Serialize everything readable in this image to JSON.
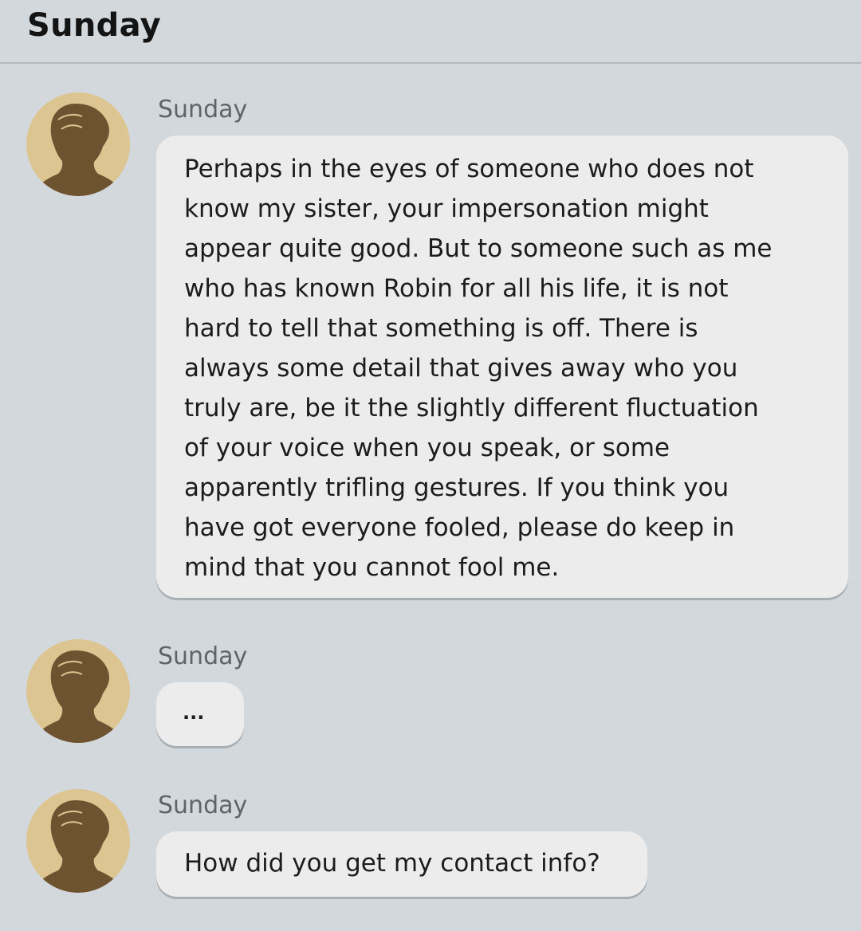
{
  "header": {
    "title": "Sunday"
  },
  "messages": [
    {
      "sender": "Sunday",
      "text": "Perhaps in the eyes of someone who does not\nknow my sister, your impersonation might\nappear quite good. But to someone such as me\nwho has known Robin for all his life, it is not\nhard to tell that something is off. There is\nalways some detail that gives away who you\ntruly are, be it the slightly different fluctuation\nof your voice when you speak, or some\napparently trifling gestures. If you think you\nhave got everyone fooled, please do keep in\nmind that you cannot fool me."
    },
    {
      "sender": "Sunday",
      "text": "..."
    },
    {
      "sender": "Sunday",
      "text": "How did you get my contact info?"
    }
  ],
  "colors": {
    "background": "#d3d8dd",
    "bubble": "#ececec",
    "avatar_bg": "#dcc590",
    "avatar_silhouette": "#6e5331"
  },
  "icons": {
    "avatar": "person-silhouette-icon"
  }
}
